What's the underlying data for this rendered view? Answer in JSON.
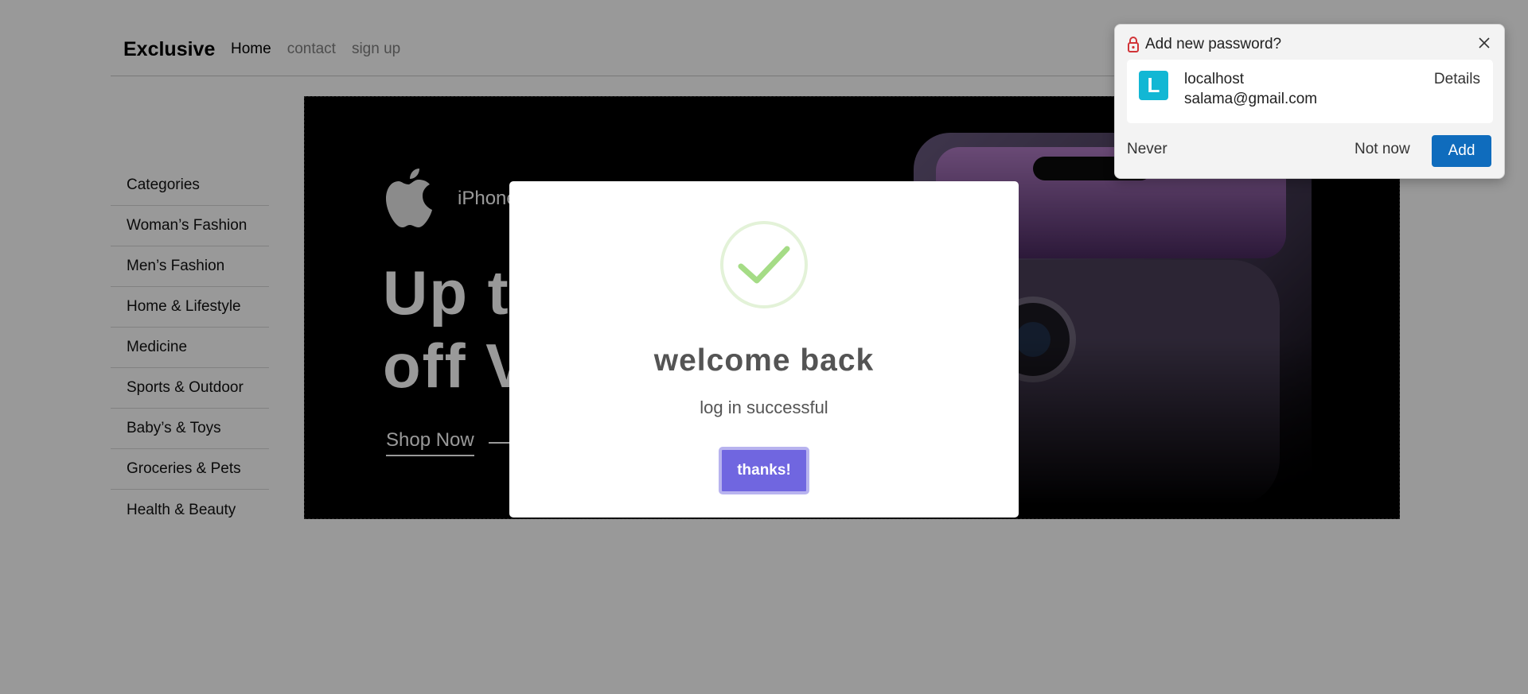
{
  "navbar": {
    "brand": "Exclusive",
    "links": [
      "Home",
      "contact",
      "sign up"
    ]
  },
  "sidebar": {
    "items": [
      "Categories",
      "Woman’s Fashion",
      "Men’s Fashion",
      "Home & Lifestyle",
      "Medicine",
      "Sports & Outdoor",
      "Baby’s & Toys",
      "Groceries & Pets",
      "Health & Beauty"
    ]
  },
  "hero": {
    "brand_label": "iPhone",
    "headline_line1": "Up t",
    "headline_line2": "off V",
    "cta": "Shop Now"
  },
  "modal": {
    "title": "welcome back",
    "text": "log in successful",
    "button": "thanks!"
  },
  "password_popup": {
    "title": "Add new password?",
    "avatar_letter": "L",
    "site": "localhost",
    "username": "salama@gmail.com",
    "details": "Details",
    "never": "Never",
    "not_now": "Not now",
    "add": "Add"
  },
  "colors": {
    "modal_button": "#7066e0",
    "success_check": "#a5dc86",
    "popup_add": "#0f6cbd",
    "avatar": "#12b7d4",
    "lock_icon": "#d13438"
  },
  "icons": [
    "apple-logo-icon",
    "arrow-right-icon",
    "success-check-icon",
    "lock-icon",
    "close-icon"
  ]
}
